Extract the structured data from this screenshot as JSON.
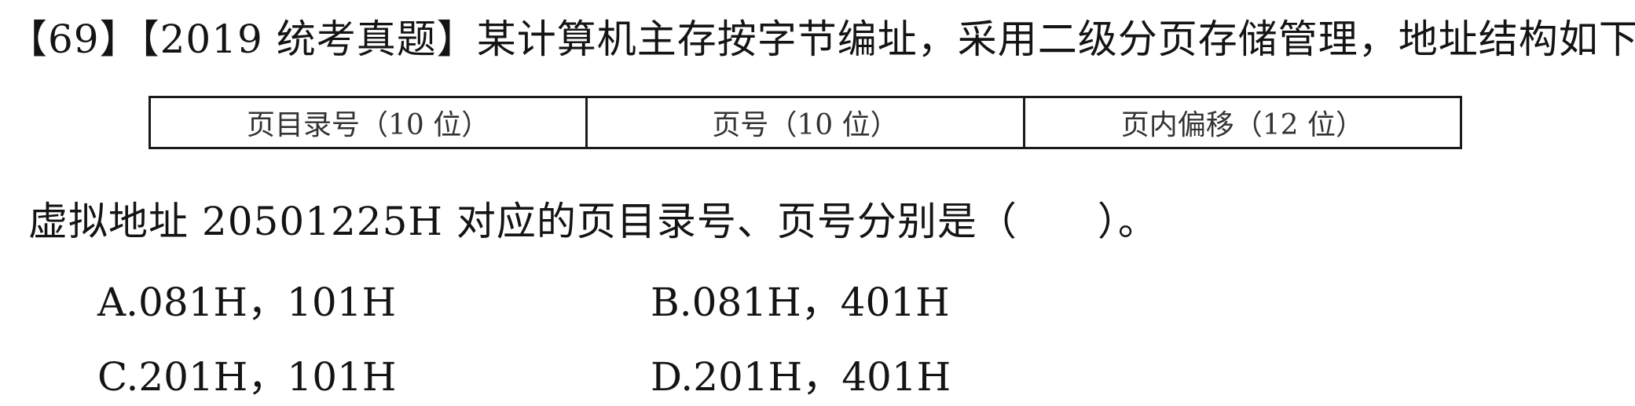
{
  "question": {
    "title": "【69】【2019 统考真题】某计算机主存按字节编址，采用二级分页存储管理，地址结构如下:",
    "body": "虚拟地址 20501225H 对应的页目录号、页号分别是（　　）。"
  },
  "address_structure": {
    "cells": [
      "页目录号（10 位）",
      "页号（10 位）",
      "页内偏移（12 位）"
    ]
  },
  "options": {
    "a": "A.081H，101H",
    "b": "B.081H，401H",
    "c": "C.201H，101H",
    "d": "D.201H，401H"
  }
}
